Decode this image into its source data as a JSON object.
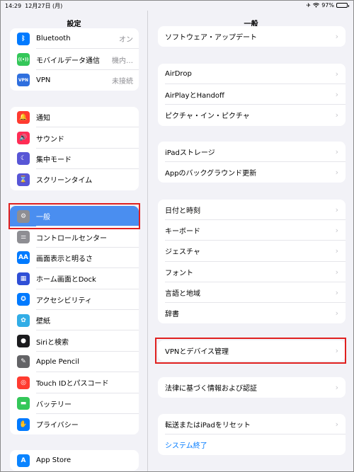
{
  "status_bar": {
    "time": "14:29",
    "date": "12月27日 (月)",
    "battery": "97%",
    "battery_level": 0.97
  },
  "sidebar": {
    "title": "設定",
    "group1": [
      {
        "label": "Bluetooth",
        "value": "オン",
        "icon": "bluetooth-icon",
        "color": "#007aff"
      },
      {
        "label": "モバイルデータ通信",
        "value": "機内…",
        "icon": "antenna-icon",
        "color": "#34c759"
      },
      {
        "label": "VPN",
        "value": "未接続",
        "icon": "vpn-icon",
        "color": "#2f6fde"
      }
    ],
    "group2": [
      {
        "label": "通知",
        "icon": "bell-icon",
        "color": "#ff3b30"
      },
      {
        "label": "サウンド",
        "icon": "speaker-icon",
        "color": "#ff2d55"
      },
      {
        "label": "集中モード",
        "icon": "moon-icon",
        "color": "#5856d6"
      },
      {
        "label": "スクリーンタイム",
        "icon": "hourglass-icon",
        "color": "#5856d6"
      }
    ],
    "group3": [
      {
        "label": "一般",
        "icon": "gear-icon",
        "color": "#8e8e93",
        "selected": true
      },
      {
        "label": "コントロールセンター",
        "icon": "toggles-icon",
        "color": "#8e8e93"
      },
      {
        "label": "画面表示と明るさ",
        "icon": "text-size-icon",
        "color": "#007aff"
      },
      {
        "label": "ホーム画面とDock",
        "icon": "home-grid-icon",
        "color": "#2f4fd6"
      },
      {
        "label": "アクセシビリティ",
        "icon": "accessibility-icon",
        "color": "#007aff"
      },
      {
        "label": "壁紙",
        "icon": "wallpaper-icon",
        "color": "#32ade6"
      },
      {
        "label": "Siriと検索",
        "icon": "siri-icon",
        "color": "#1c1c1e"
      },
      {
        "label": "Apple Pencil",
        "icon": "pencil-icon",
        "color": "#636366"
      },
      {
        "label": "Touch IDとパスコード",
        "icon": "fingerprint-icon",
        "color": "#ff3b30"
      },
      {
        "label": "バッテリー",
        "icon": "battery-icon",
        "color": "#34c759"
      },
      {
        "label": "プライバシー",
        "icon": "hand-icon",
        "color": "#007aff"
      }
    ],
    "group4": [
      {
        "label": "App Store",
        "icon": "appstore-icon",
        "color": "#0a84ff"
      }
    ]
  },
  "detail": {
    "title": "一般",
    "group0": [
      {
        "label": "ソフトウェア・アップデート"
      }
    ],
    "group1": [
      {
        "label": "AirDrop"
      },
      {
        "label": "AirPlayとHandoff"
      },
      {
        "label": "ピクチャ・イン・ピクチャ"
      }
    ],
    "group2": [
      {
        "label": "iPadストレージ"
      },
      {
        "label": "Appのバックグラウンド更新"
      }
    ],
    "group3": [
      {
        "label": "日付と時刻"
      },
      {
        "label": "キーボード"
      },
      {
        "label": "ジェスチャ"
      },
      {
        "label": "フォント"
      },
      {
        "label": "言語と地域"
      },
      {
        "label": "辞書"
      }
    ],
    "group4": [
      {
        "label": "VPNとデバイス管理"
      }
    ],
    "group5": [
      {
        "label": "法律に基づく情報および認証"
      }
    ],
    "group6": [
      {
        "label": "転送またはiPadをリセット"
      },
      {
        "label": "システム終了",
        "link": true
      }
    ],
    "chevron": "›"
  }
}
